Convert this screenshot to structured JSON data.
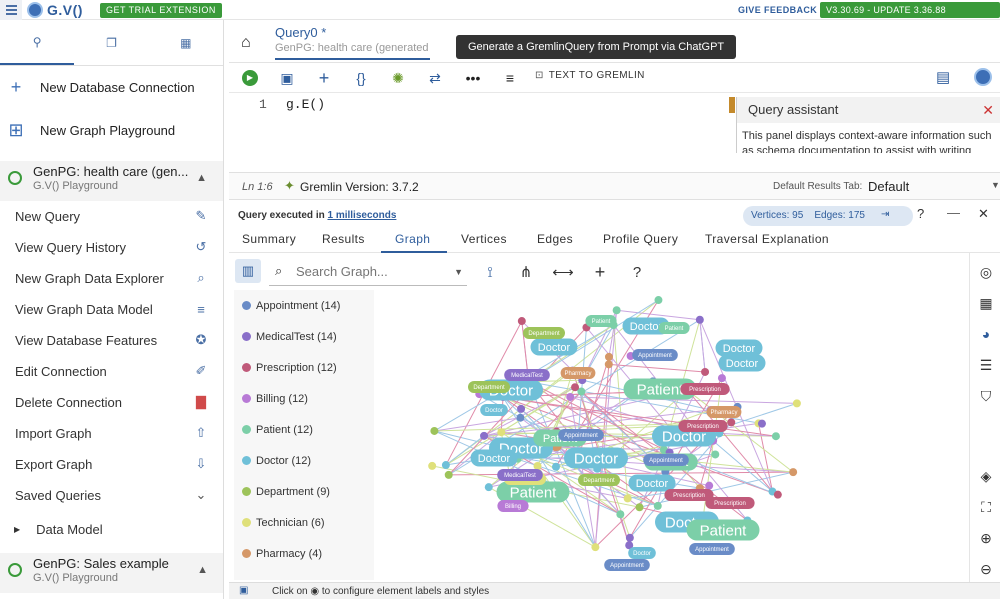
{
  "app": {
    "brand": "G.V()",
    "trial_button": "GET TRIAL EXTENSION",
    "feedback": "GIVE FEEDBACK",
    "version": "V3.30.69 - UPDATE 3.36.88 AVAILABLE"
  },
  "sidebar": {
    "actions": [
      {
        "label": "New Database Connection",
        "icon": "plus-icon"
      },
      {
        "label": "New Graph Playground",
        "icon": "cpu-icon"
      }
    ],
    "connection": {
      "title": "GenPG: health care (gen...",
      "subtitle": "G.V() Playground"
    },
    "items": [
      {
        "label": "New Query",
        "icon": "magic-wand-icon"
      },
      {
        "label": "View Query History",
        "icon": "history-icon"
      },
      {
        "label": "New Graph Data Explorer",
        "icon": "explore-icon"
      },
      {
        "label": "View Graph Data Model",
        "icon": "database-icon"
      },
      {
        "label": "View Database Features",
        "icon": "star-icon"
      },
      {
        "label": "Edit Connection",
        "icon": "edit-icon"
      },
      {
        "label": "Delete Connection",
        "icon": "trash-icon"
      },
      {
        "label": "Import Graph",
        "icon": "upload-icon"
      },
      {
        "label": "Export Graph",
        "icon": "download-icon"
      },
      {
        "label": "Saved Queries",
        "icon": "chevron-down-icon"
      }
    ],
    "data_model": "Data Model",
    "connection2": {
      "title": "GenPG: Sales example",
      "subtitle": "G.V() Playground"
    }
  },
  "editor": {
    "tab_title": "Query0 *",
    "tab_subtitle": "GenPG: health care (generated",
    "tooltip": "Generate a GremlinQuery from Prompt via ChatGPT",
    "text_to_gremlin": "TEXT TO GREMLIN",
    "line_number": "1",
    "code": "g.E()",
    "assistant_title": "Query assistant",
    "assistant_body": "This panel displays context-aware information such as schema documentation to assist with writing graph queries",
    "position": "Ln 1:6",
    "gremlin_version": "Gremlin Version: 3.7.2",
    "default_results_label": "Default Results Tab:",
    "default_results_value": "Default"
  },
  "results": {
    "exec_prefix": "Query executed in ",
    "exec_time": "1 milliseconds",
    "vertices": "Vertices: 95",
    "edges": "Edges: 175",
    "tabs": [
      "Summary",
      "Results",
      "Graph",
      "Vertices",
      "Edges",
      "Profile Query",
      "Traversal Explanation"
    ],
    "active_tab": "Graph",
    "search_placeholder": "Search Graph...",
    "bottom_hint": "Click on ◉ to configure element labels and styles"
  },
  "legend": [
    {
      "label": "Appointment (14)",
      "color": "#6a8cc7"
    },
    {
      "label": "MedicalTest (14)",
      "color": "#8a6fc9"
    },
    {
      "label": "Prescription (12)",
      "color": "#c05a7a"
    },
    {
      "label": "Billing (12)",
      "color": "#b87ad6"
    },
    {
      "label": "Patient (12)",
      "color": "#7ccfa8"
    },
    {
      "label": "Doctor (12)",
      "color": "#6fc0d8"
    },
    {
      "label": "Department (9)",
      "color": "#9dc35a"
    },
    {
      "label": "Technician (6)",
      "color": "#dfe07a"
    },
    {
      "label": "Pharmacy (4)",
      "color": "#d59868"
    }
  ],
  "graph_labels": {
    "big": [
      "Doctor",
      "Doctor",
      "Doctor",
      "Doctor",
      "Doctor",
      "Patient",
      "Patient",
      "Patient"
    ],
    "small": [
      "Doctor",
      "Doctor",
      "Doctor",
      "Patient",
      "Patient",
      "Doctor",
      "Doctor",
      "Doctor"
    ],
    "tiny": [
      "Department",
      "Patient",
      "Appointment",
      "MedicalTest",
      "Pharmacy",
      "Prescription",
      "Department",
      "Appointment",
      "Billing",
      "Technician",
      "Prescription",
      "Appointment",
      "Department",
      "Pharmacy",
      "Prescription",
      "MedicalTest",
      "Doctor",
      "Appointment",
      "Appointment",
      "Doctor",
      "Patient",
      "Prescription"
    ]
  }
}
